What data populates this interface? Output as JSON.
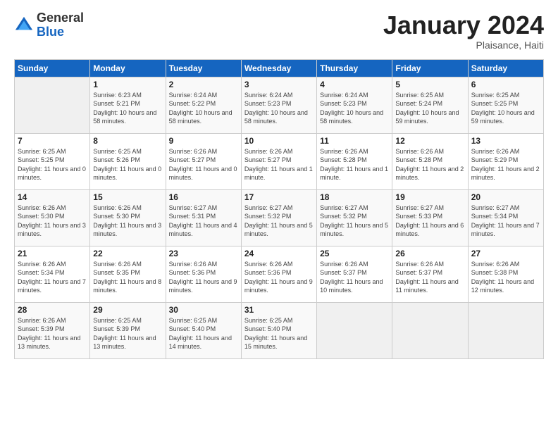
{
  "logo": {
    "general": "General",
    "blue": "Blue"
  },
  "header": {
    "title": "January 2024",
    "subtitle": "Plaisance, Haiti"
  },
  "weekdays": [
    "Sunday",
    "Monday",
    "Tuesday",
    "Wednesday",
    "Thursday",
    "Friday",
    "Saturday"
  ],
  "weeks": [
    [
      {
        "day": "",
        "sunrise": "",
        "sunset": "",
        "daylight": ""
      },
      {
        "day": "1",
        "sunrise": "Sunrise: 6:23 AM",
        "sunset": "Sunset: 5:21 PM",
        "daylight": "Daylight: 10 hours and 58 minutes."
      },
      {
        "day": "2",
        "sunrise": "Sunrise: 6:24 AM",
        "sunset": "Sunset: 5:22 PM",
        "daylight": "Daylight: 10 hours and 58 minutes."
      },
      {
        "day": "3",
        "sunrise": "Sunrise: 6:24 AM",
        "sunset": "Sunset: 5:23 PM",
        "daylight": "Daylight: 10 hours and 58 minutes."
      },
      {
        "day": "4",
        "sunrise": "Sunrise: 6:24 AM",
        "sunset": "Sunset: 5:23 PM",
        "daylight": "Daylight: 10 hours and 58 minutes."
      },
      {
        "day": "5",
        "sunrise": "Sunrise: 6:25 AM",
        "sunset": "Sunset: 5:24 PM",
        "daylight": "Daylight: 10 hours and 59 minutes."
      },
      {
        "day": "6",
        "sunrise": "Sunrise: 6:25 AM",
        "sunset": "Sunset: 5:25 PM",
        "daylight": "Daylight: 10 hours and 59 minutes."
      }
    ],
    [
      {
        "day": "7",
        "sunrise": "Sunrise: 6:25 AM",
        "sunset": "Sunset: 5:25 PM",
        "daylight": "Daylight: 11 hours and 0 minutes."
      },
      {
        "day": "8",
        "sunrise": "Sunrise: 6:25 AM",
        "sunset": "Sunset: 5:26 PM",
        "daylight": "Daylight: 11 hours and 0 minutes."
      },
      {
        "day": "9",
        "sunrise": "Sunrise: 6:26 AM",
        "sunset": "Sunset: 5:27 PM",
        "daylight": "Daylight: 11 hours and 0 minutes."
      },
      {
        "day": "10",
        "sunrise": "Sunrise: 6:26 AM",
        "sunset": "Sunset: 5:27 PM",
        "daylight": "Daylight: 11 hours and 1 minute."
      },
      {
        "day": "11",
        "sunrise": "Sunrise: 6:26 AM",
        "sunset": "Sunset: 5:28 PM",
        "daylight": "Daylight: 11 hours and 1 minute."
      },
      {
        "day": "12",
        "sunrise": "Sunrise: 6:26 AM",
        "sunset": "Sunset: 5:28 PM",
        "daylight": "Daylight: 11 hours and 2 minutes."
      },
      {
        "day": "13",
        "sunrise": "Sunrise: 6:26 AM",
        "sunset": "Sunset: 5:29 PM",
        "daylight": "Daylight: 11 hours and 2 minutes."
      }
    ],
    [
      {
        "day": "14",
        "sunrise": "Sunrise: 6:26 AM",
        "sunset": "Sunset: 5:30 PM",
        "daylight": "Daylight: 11 hours and 3 minutes."
      },
      {
        "day": "15",
        "sunrise": "Sunrise: 6:26 AM",
        "sunset": "Sunset: 5:30 PM",
        "daylight": "Daylight: 11 hours and 3 minutes."
      },
      {
        "day": "16",
        "sunrise": "Sunrise: 6:27 AM",
        "sunset": "Sunset: 5:31 PM",
        "daylight": "Daylight: 11 hours and 4 minutes."
      },
      {
        "day": "17",
        "sunrise": "Sunrise: 6:27 AM",
        "sunset": "Sunset: 5:32 PM",
        "daylight": "Daylight: 11 hours and 5 minutes."
      },
      {
        "day": "18",
        "sunrise": "Sunrise: 6:27 AM",
        "sunset": "Sunset: 5:32 PM",
        "daylight": "Daylight: 11 hours and 5 minutes."
      },
      {
        "day": "19",
        "sunrise": "Sunrise: 6:27 AM",
        "sunset": "Sunset: 5:33 PM",
        "daylight": "Daylight: 11 hours and 6 minutes."
      },
      {
        "day": "20",
        "sunrise": "Sunrise: 6:27 AM",
        "sunset": "Sunset: 5:34 PM",
        "daylight": "Daylight: 11 hours and 7 minutes."
      }
    ],
    [
      {
        "day": "21",
        "sunrise": "Sunrise: 6:26 AM",
        "sunset": "Sunset: 5:34 PM",
        "daylight": "Daylight: 11 hours and 7 minutes."
      },
      {
        "day": "22",
        "sunrise": "Sunrise: 6:26 AM",
        "sunset": "Sunset: 5:35 PM",
        "daylight": "Daylight: 11 hours and 8 minutes."
      },
      {
        "day": "23",
        "sunrise": "Sunrise: 6:26 AM",
        "sunset": "Sunset: 5:36 PM",
        "daylight": "Daylight: 11 hours and 9 minutes."
      },
      {
        "day": "24",
        "sunrise": "Sunrise: 6:26 AM",
        "sunset": "Sunset: 5:36 PM",
        "daylight": "Daylight: 11 hours and 9 minutes."
      },
      {
        "day": "25",
        "sunrise": "Sunrise: 6:26 AM",
        "sunset": "Sunset: 5:37 PM",
        "daylight": "Daylight: 11 hours and 10 minutes."
      },
      {
        "day": "26",
        "sunrise": "Sunrise: 6:26 AM",
        "sunset": "Sunset: 5:37 PM",
        "daylight": "Daylight: 11 hours and 11 minutes."
      },
      {
        "day": "27",
        "sunrise": "Sunrise: 6:26 AM",
        "sunset": "Sunset: 5:38 PM",
        "daylight": "Daylight: 11 hours and 12 minutes."
      }
    ],
    [
      {
        "day": "28",
        "sunrise": "Sunrise: 6:26 AM",
        "sunset": "Sunset: 5:39 PM",
        "daylight": "Daylight: 11 hours and 13 minutes."
      },
      {
        "day": "29",
        "sunrise": "Sunrise: 6:25 AM",
        "sunset": "Sunset: 5:39 PM",
        "daylight": "Daylight: 11 hours and 13 minutes."
      },
      {
        "day": "30",
        "sunrise": "Sunrise: 6:25 AM",
        "sunset": "Sunset: 5:40 PM",
        "daylight": "Daylight: 11 hours and 14 minutes."
      },
      {
        "day": "31",
        "sunrise": "Sunrise: 6:25 AM",
        "sunset": "Sunset: 5:40 PM",
        "daylight": "Daylight: 11 hours and 15 minutes."
      },
      {
        "day": "",
        "sunrise": "",
        "sunset": "",
        "daylight": ""
      },
      {
        "day": "",
        "sunrise": "",
        "sunset": "",
        "daylight": ""
      },
      {
        "day": "",
        "sunrise": "",
        "sunset": "",
        "daylight": ""
      }
    ]
  ]
}
